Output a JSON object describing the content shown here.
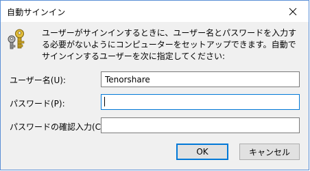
{
  "window": {
    "title": "自動サインイン"
  },
  "description": "ユーザーがサインインするときに、ユーザー名とパスワードを入力する必要がないようにコンピューターをセットアップできます。自動でサインインするユーザーを次に指定してください:",
  "fields": {
    "username": {
      "label": "ユーザー名(U):",
      "value": "Tenorshare"
    },
    "password": {
      "label": "パスワード(P):",
      "value": ""
    },
    "confirm_password": {
      "label": "パスワードの確認入力(C):",
      "value": ""
    }
  },
  "buttons": {
    "ok": "OK",
    "cancel": "キャンセル"
  },
  "icons": {
    "close": "close-icon",
    "keys": "keys-icon"
  },
  "colors": {
    "accent": "#0078d7",
    "button_bg": "#e1e1e1",
    "dialog_bg": "#f0f0f0"
  }
}
